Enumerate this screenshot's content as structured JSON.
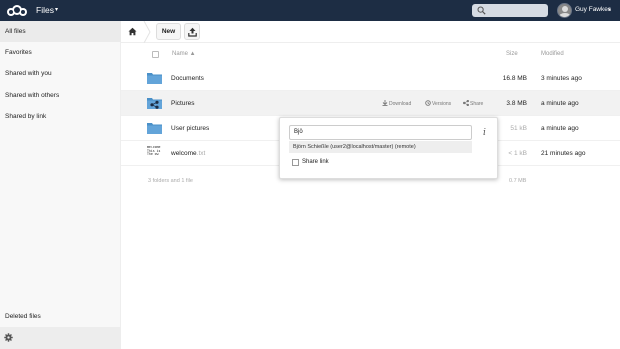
{
  "header": {
    "app_title": "Files",
    "app_caret": "▾",
    "username": "Guy Fawkes",
    "user_caret": "▾",
    "bg_color": "#1d2d44"
  },
  "search": {
    "placeholder": ""
  },
  "sidebar": {
    "items": [
      {
        "label": "All files",
        "active": true
      },
      {
        "label": "Favorites"
      },
      {
        "label": "Shared with you"
      },
      {
        "label": "Shared with others"
      },
      {
        "label": "Shared by link"
      }
    ],
    "deleted_label": "Deleted files",
    "settings_icon": "gear-icon"
  },
  "controls": {
    "new_label": "New",
    "home_icon": "home-icon",
    "upload_icon": "upload-icon"
  },
  "table": {
    "col_name": "Name ▲",
    "col_size": "Size",
    "col_modified": "Modified",
    "rows": [
      {
        "name": "Documents",
        "ext": "",
        "size": "16.8 MB",
        "modified": "3 minutes ago",
        "type": "folder"
      },
      {
        "name": "Pictures",
        "ext": "",
        "size": "3.8 MB",
        "modified": "a minute ago",
        "type": "shared-folder"
      },
      {
        "name": "User pictures",
        "ext": "",
        "size": "51 kB",
        "modified": "a minute ago",
        "type": "folder"
      },
      {
        "name": "welcome",
        "ext": ".txt",
        "size": "< 1 kB",
        "modified": "21 minutes ago",
        "type": "text"
      }
    ],
    "txt_thumb": "Welcome\nThis is\nThe ow",
    "actions": {
      "download": "Download",
      "versions": "Versions",
      "share": "Share"
    },
    "summary_count": "3 folders and 1 file",
    "summary_size": "0.7 MB"
  },
  "share_dropdown": {
    "input_value": "Bjö",
    "suggestion": "Björn Schießle (user2@localhost/master) (remote)",
    "share_link_label": "Share link",
    "info_icon": "i"
  }
}
